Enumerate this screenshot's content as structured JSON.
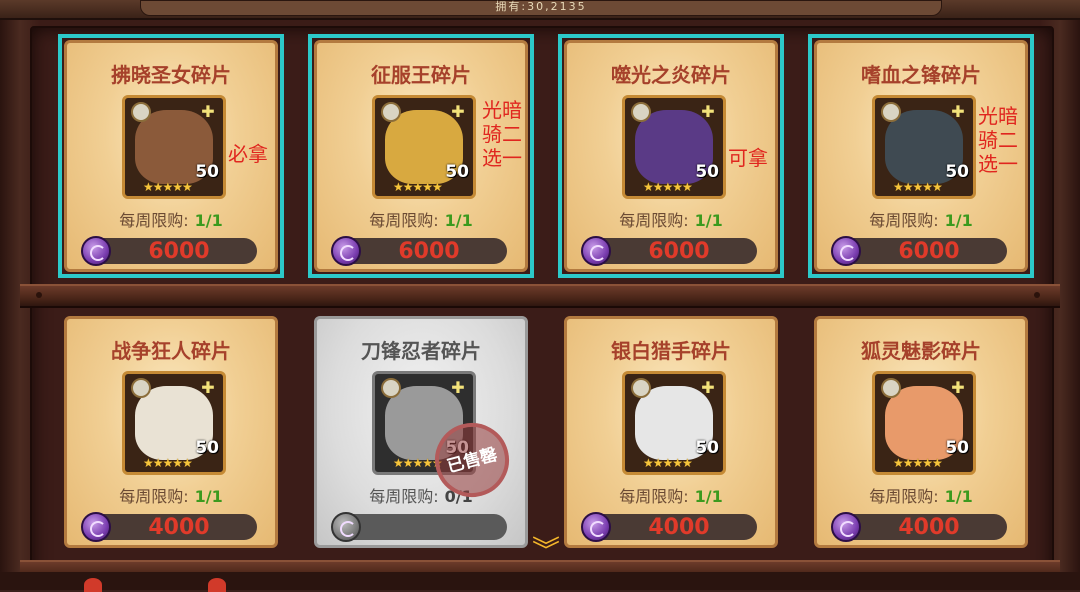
{
  "header": {
    "title": "拥有:30,2135"
  },
  "cards": [
    {
      "name": "拂晓圣女碎片",
      "limit_label": "每周限购:",
      "limit_value": "1/1",
      "level": "50",
      "price": "6000",
      "stars": "★★★★★",
      "class_icon": "✚",
      "sold_out": false,
      "highlighted": true,
      "face_color": "#8b5a3a",
      "note": "必拿"
    },
    {
      "name": "征服王碎片",
      "limit_label": "每周限购:",
      "limit_value": "1/1",
      "level": "50",
      "price": "6000",
      "stars": "★★★★★",
      "class_icon": "✚",
      "sold_out": false,
      "highlighted": true,
      "face_color": "#d8a940",
      "note": "光暗\n骑二\n选一"
    },
    {
      "name": "噬光之炎碎片",
      "limit_label": "每周限购:",
      "limit_value": "1/1",
      "level": "50",
      "price": "6000",
      "stars": "★★★★★",
      "class_icon": "✚",
      "sold_out": false,
      "highlighted": true,
      "face_color": "#5a3a86",
      "note": "可拿"
    },
    {
      "name": "嗜血之锋碎片",
      "limit_label": "每周限购:",
      "limit_value": "1/1",
      "level": "50",
      "price": "6000",
      "stars": "★★★★★",
      "class_icon": "✚",
      "sold_out": false,
      "highlighted": true,
      "face_color": "#3f4a52",
      "note": "光暗\n骑二\n选一"
    },
    {
      "name": "战争狂人碎片",
      "limit_label": "每周限购:",
      "limit_value": "1/1",
      "level": "50",
      "price": "4000",
      "stars": "★★★★★",
      "class_icon": "✚",
      "sold_out": false,
      "highlighted": false,
      "face_color": "#e9e2d4"
    },
    {
      "name": "刀锋忍者碎片",
      "limit_label": "每周限购:",
      "limit_value": "0/1",
      "level": "50",
      "price": "",
      "stars": "★★★★★",
      "class_icon": "✚",
      "sold_out": true,
      "highlighted": false,
      "face_color": "#9a9a9a",
      "stamp": "已售罄"
    },
    {
      "name": "银白猎手碎片",
      "limit_label": "每周限购:",
      "limit_value": "1/1",
      "level": "50",
      "price": "4000",
      "stars": "★★★★★",
      "class_icon": "✚",
      "sold_out": false,
      "highlighted": false,
      "face_color": "#e6e6e6"
    },
    {
      "name": "狐灵魅影碎片",
      "limit_label": "每周限购:",
      "limit_value": "1/1",
      "level": "50",
      "price": "4000",
      "stars": "★★★★★",
      "class_icon": "✚",
      "sold_out": false,
      "highlighted": false,
      "face_color": "#e89a6a"
    }
  ],
  "colors": {
    "highlight": "#2cc9c9",
    "note_red": "#e0261f",
    "price_red": "#e03a2a",
    "limit_green": "#3b9a1e"
  },
  "icons": {
    "currency": "purple-coin-icon",
    "scroll": "chevron-down-icon"
  }
}
